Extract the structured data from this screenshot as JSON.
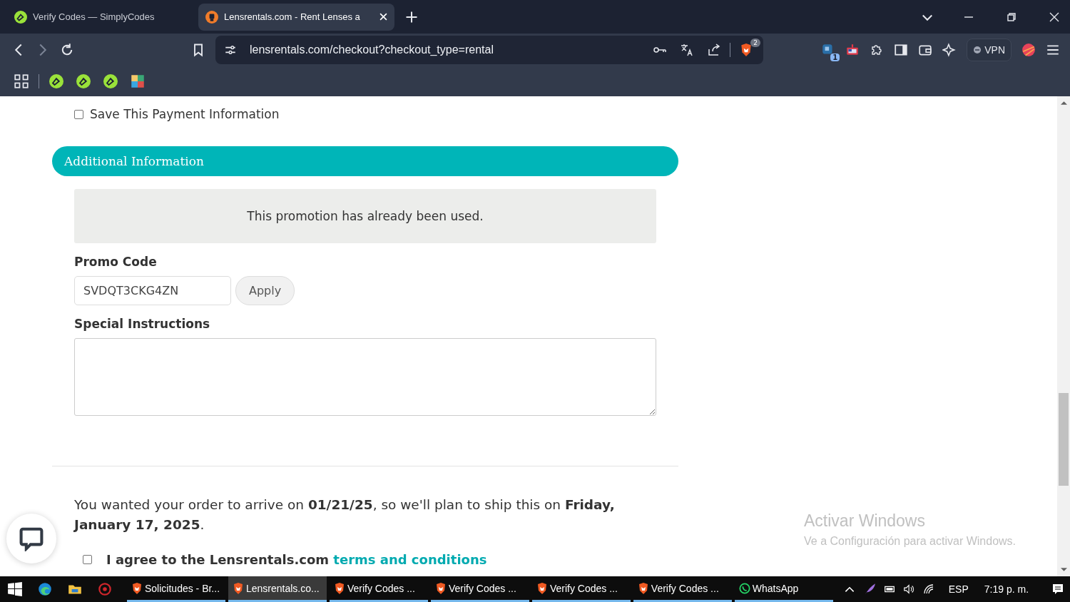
{
  "browser": {
    "tabs": [
      {
        "title": "Verify Codes — SimplyCodes",
        "selected": false
      },
      {
        "title": "Lensrentals.com - Rent Lenses a",
        "selected": true
      }
    ],
    "address": "lensrentals.com/checkout?checkout_type=rental",
    "shield_count": "2",
    "extension_badge": "1",
    "vpn_label": "VPN"
  },
  "page": {
    "save_payment": {
      "label": "Save This Payment Information",
      "checked": false
    },
    "section_title": "Additional Information",
    "alert": "This promotion has already been used.",
    "promo": {
      "label": "Promo Code",
      "value": "SVDQT3CKG4ZN",
      "button": "Apply"
    },
    "instructions": {
      "label": "Special Instructions"
    },
    "shipping_note": "You wanted your order to arrive on **01/21/25**, so we'll plan to ship this on **Friday, January 17, 2025**.",
    "agree": {
      "text": "I agree to the Lensrentals.com ",
      "link": "terms and conditions",
      "checked": false
    }
  },
  "activation": {
    "title": "Activar Windows",
    "subtitle": "Ve a Configuración para activar Windows."
  },
  "taskbar": {
    "apps": [
      {
        "label": "Solicitudes - Br...",
        "selected": false
      },
      {
        "label": "Lensrentals.co...",
        "selected": true
      },
      {
        "label": "Verify Codes ...",
        "selected": false
      },
      {
        "label": "Verify Codes ...",
        "selected": false
      },
      {
        "label": "Verify Codes ...",
        "selected": false
      },
      {
        "label": "Verify Codes ...",
        "selected": false
      },
      {
        "label": "WhatsApp",
        "selected": false
      }
    ],
    "language": "ESP",
    "time": "7:19 p. m."
  }
}
